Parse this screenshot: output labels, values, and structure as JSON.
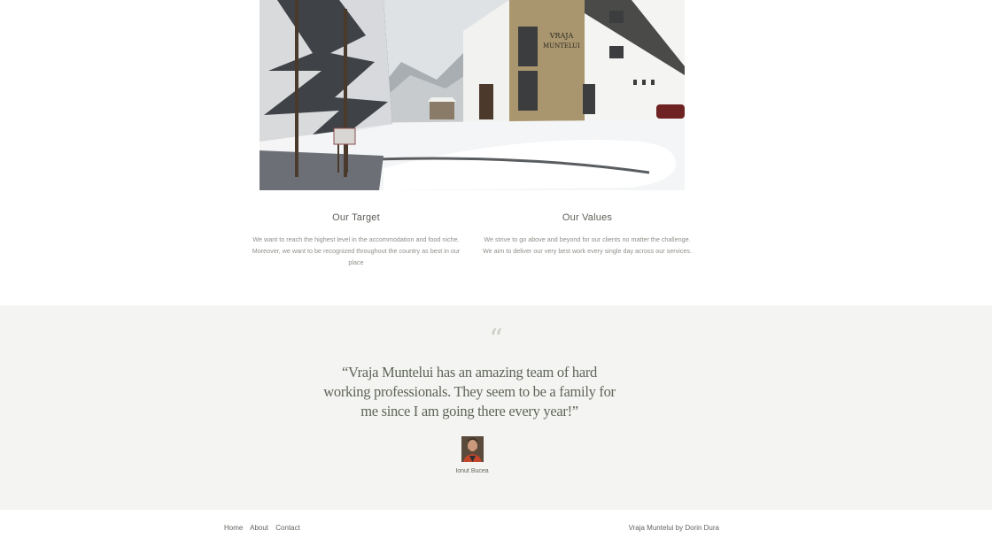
{
  "photo": {
    "alt_sign_text": "Vraja Muntelui"
  },
  "target": {
    "title": "Our Target",
    "text": "We want to reach the highest level in the accommodation and food niche. Moreover, we want to be recognized throughout the country as best in our place"
  },
  "values": {
    "title": "Our Values",
    "text": "We strive to go above and beyond for our clients no matter the challenge. We aim to deliver our very best work every single day across our services."
  },
  "testimonial": {
    "mark": "“",
    "quote": "“Vraja Muntelui has an amazing team of hard working professionals. They seem to be a family for me since I am going there every year!”",
    "author": "Ionut Bucea"
  },
  "footer": {
    "nav": [
      "Home",
      "About",
      "Contact"
    ],
    "credit": "Vraja Muntelui by Dorin Dura"
  },
  "colors": {
    "band_bg": "#f4f5f2",
    "text_dark": "#5c5f57",
    "text_muted": "#8e918a"
  }
}
